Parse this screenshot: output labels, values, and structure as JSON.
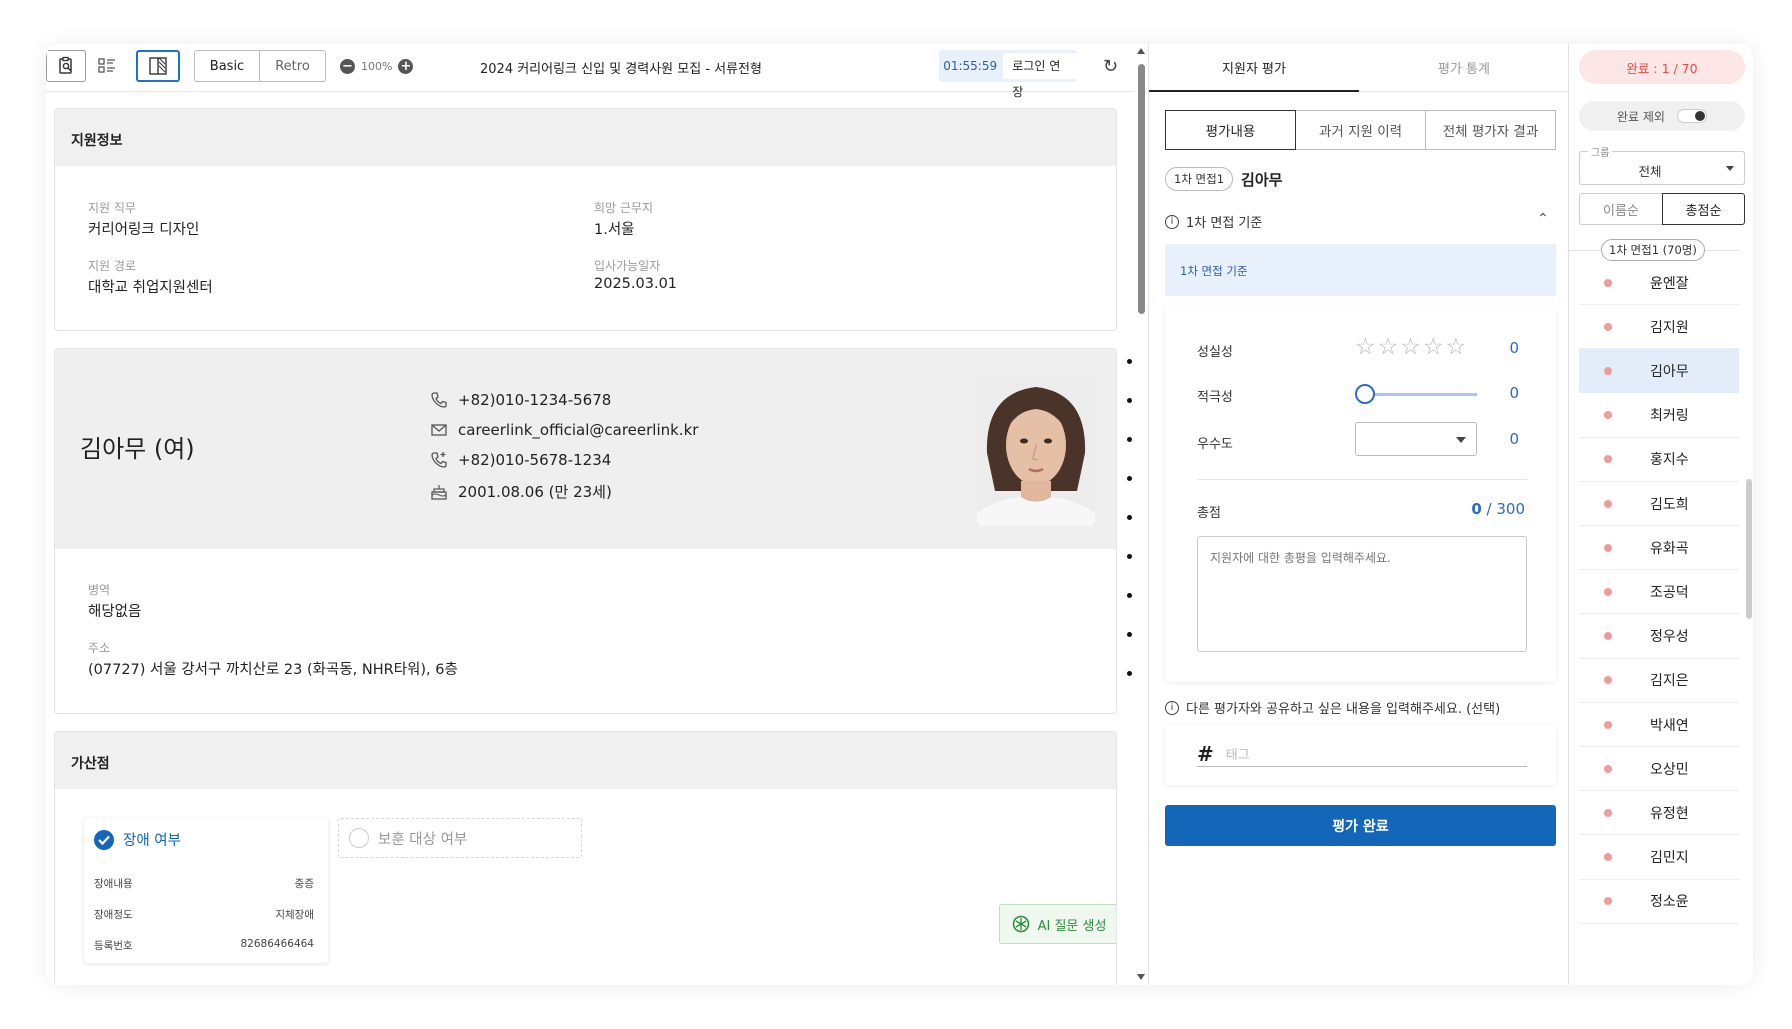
{
  "toolbar": {
    "mode_basic": "Basic",
    "mode_retro": "Retro",
    "zoom": "100%",
    "doc_title": "2024 커리어링크 신입 및 경력사원 모집 - 서류전형",
    "timer": "01:55:59",
    "login_extend": "로그인 연장"
  },
  "applicant_info": {
    "title": "지원정보",
    "fields": [
      {
        "label": "지원 직무",
        "value": "커리어링크 디자인"
      },
      {
        "label": "희망 근무지",
        "value": "1.서울"
      },
      {
        "label": "지원 경로",
        "value": "대학교 취업지원센터"
      },
      {
        "label": "입사가능일자",
        "value": "2025.03.01"
      }
    ]
  },
  "profile": {
    "name": "김아무 (여)",
    "phone": "+82)010-1234-5678",
    "email": "careerlink_official@careerlink.kr",
    "phone2": "+82)010-5678-1234",
    "birth": "2001.08.06 (만 23세)",
    "military_label": "병역",
    "military_value": "해당없음",
    "address_label": "주소",
    "address_value": "(07727) 서울 강서구 까치산로 23 (화곡동, NHR타워), 6층"
  },
  "bonus": {
    "title": "가산점",
    "disability_label": "장애 여부",
    "protected_label": "보훈 대상 여부",
    "rows": [
      {
        "label": "장애내용",
        "value": "중증"
      },
      {
        "label": "장애정도",
        "value": "지체장애"
      },
      {
        "label": "등록번호",
        "value": "82686466464"
      }
    ],
    "ai_button": "AI 질문 생성"
  },
  "evaluation": {
    "tabs": [
      "지원자 평가",
      "평가 통계"
    ],
    "subtabs": [
      "평가내용",
      "과거 지원 이력",
      "전체 평가자 결과"
    ],
    "stage_badge": "1차 면접1",
    "applicant": "김아무",
    "criteria_title": "1차 면접 기준",
    "criteria_box": "1차 면접 기준",
    "criteria": [
      {
        "name": "성실성",
        "score": "0"
      },
      {
        "name": "적극성",
        "score": "0"
      },
      {
        "name": "우수도",
        "score": "0"
      }
    ],
    "slider_value": 0,
    "stars_filled": 0,
    "total_label": "총점",
    "total_score": "0",
    "total_max": "/ 300",
    "comment_placeholder": "지원자에 대한 총평을 입력해주세요.",
    "share_note": "다른 평가자와 공유하고 싶은 내용을 입력해주세요. (선택)",
    "tag_placeholder": "태그",
    "submit": "평가 완료"
  },
  "list": {
    "progress": "완료 : 1 / 70",
    "exclude_label": "완료 제외",
    "group_legend": "그룹",
    "group_value": "전체",
    "sort_name": "이름순",
    "sort_score": "총점순",
    "group_title": "1차 면접1 (70명)",
    "names": [
      "윤엔잘",
      "김지원",
      "김아무",
      "최커링",
      "홍지수",
      "김도희",
      "유화곡",
      "조공덕",
      "정우성",
      "김지은",
      "박새연",
      "오상민",
      "유정현",
      "김민지",
      "정소윤"
    ],
    "selected_index": 2
  },
  "colors": {
    "primary": "#1366b8",
    "selected_row": "#e3edf9",
    "accent_red": "#e84a4a",
    "dot": "#f09a9a"
  }
}
